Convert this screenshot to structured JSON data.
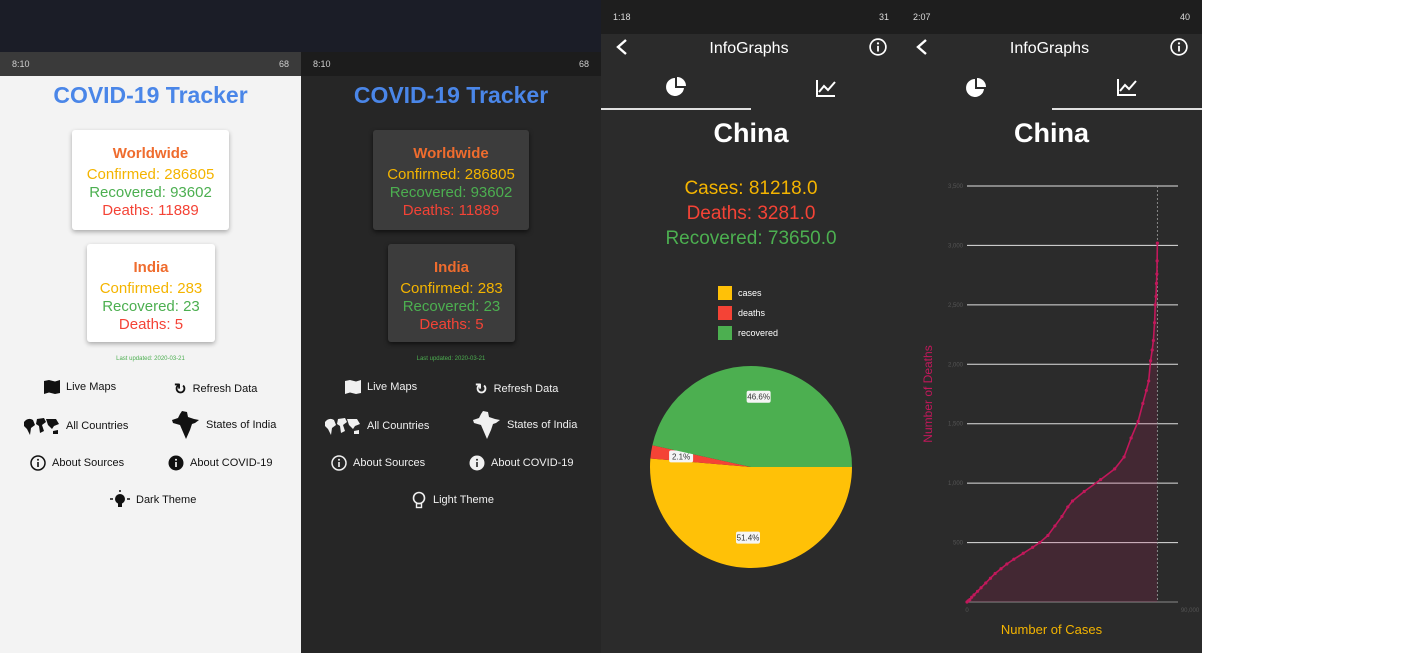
{
  "screens": {
    "light": {
      "status_time": "8:10",
      "status_battery": "68",
      "title": "COVID-19 Tracker",
      "worldwide": {
        "title": "Worldwide",
        "confirmed": "Confirmed: 286805",
        "recovered": "Recovered: 93602",
        "deaths": "Deaths: 11889"
      },
      "india": {
        "title": "India",
        "confirmed": "Confirmed: 283",
        "recovered": "Recovered: 23",
        "deaths": "Deaths: 5"
      },
      "last_updated": "Last updated: 2020-03-21",
      "buttons": {
        "live_maps": "Live Maps",
        "refresh": "Refresh Data",
        "all_countries": "All Countries",
        "states": "States of India",
        "about_sources": "About Sources",
        "about_covid": "About COVID-19",
        "theme": "Dark Theme"
      }
    },
    "dark": {
      "status_time": "8:10",
      "status_battery": "68",
      "title": "COVID-19 Tracker",
      "worldwide": {
        "title": "Worldwide",
        "confirmed": "Confirmed: 286805",
        "recovered": "Recovered: 93602",
        "deaths": "Deaths: 11889"
      },
      "india": {
        "title": "India",
        "confirmed": "Confirmed: 283",
        "recovered": "Recovered: 23",
        "deaths": "Deaths: 5"
      },
      "last_updated": "Last updated: 2020-03-21",
      "buttons": {
        "live_maps": "Live Maps",
        "refresh": "Refresh Data",
        "all_countries": "All Countries",
        "states": "States of India",
        "about_sources": "About Sources",
        "about_covid": "About COVID-19",
        "theme": "Light Theme"
      }
    },
    "pie": {
      "status_time": "1:18",
      "status_battery": "31",
      "app_title": "InfoGraphs",
      "country": "China",
      "cases": "Cases: 81218.0",
      "deaths": "Deaths: 3281.0",
      "recovered": "Recovered: 73650.0"
    },
    "line": {
      "status_time": "2:07",
      "status_battery": "40",
      "app_title": "InfoGraphs",
      "country": "China"
    }
  },
  "colors": {
    "accent_blue": "#4a86e8",
    "orange": "#ef6c2e",
    "yellow": "#f4b400",
    "green": "#4caf50",
    "red": "#f44336",
    "line_red": "#c2185b"
  },
  "chart_data": [
    {
      "type": "pie",
      "labels": [
        "cases",
        "deaths",
        "recovered"
      ],
      "values": [
        51.4,
        2.1,
        46.6
      ],
      "value_labels": [
        "51.4%",
        "2.1%",
        "46.6%"
      ],
      "colors": [
        "#ffc107",
        "#f44336",
        "#4caf50"
      ],
      "legend": "top-center"
    },
    {
      "type": "area",
      "xlabel": "Number of Cases",
      "ylabel": "Number of Deaths",
      "xlim": [
        0,
        90000
      ],
      "ylim": [
        0,
        3500
      ],
      "x_ticks": [
        "0",
        "90,000"
      ],
      "y_ticks": [
        "3,500",
        "3,000",
        "2,500",
        "2,000",
        "1,500",
        "1,000",
        "500"
      ],
      "grid": true,
      "series": [
        {
          "x": [
            0,
            500,
            1200,
            2000,
            3000,
            4500,
            6000,
            8000,
            10000,
            12000,
            14500,
            17000,
            20000,
            24000,
            28000,
            31000,
            34500,
            37500,
            40500,
            43000,
            45000,
            50000,
            57000,
            63000,
            67000,
            70000,
            73000,
            75000,
            76500,
            77500,
            78300,
            79000,
            79500,
            80000,
            80300,
            80600,
            80800,
            81000,
            81100,
            81200
          ],
          "y": [
            0,
            10,
            20,
            40,
            60,
            90,
            120,
            160,
            200,
            240,
            280,
            320,
            360,
            410,
            460,
            500,
            560,
            640,
            720,
            800,
            850,
            930,
            1030,
            1120,
            1220,
            1380,
            1520,
            1670,
            1780,
            1860,
            2030,
            2120,
            2200,
            2350,
            2500,
            2570,
            2680,
            2760,
            2870,
            3020
          ]
        }
      ]
    }
  ]
}
